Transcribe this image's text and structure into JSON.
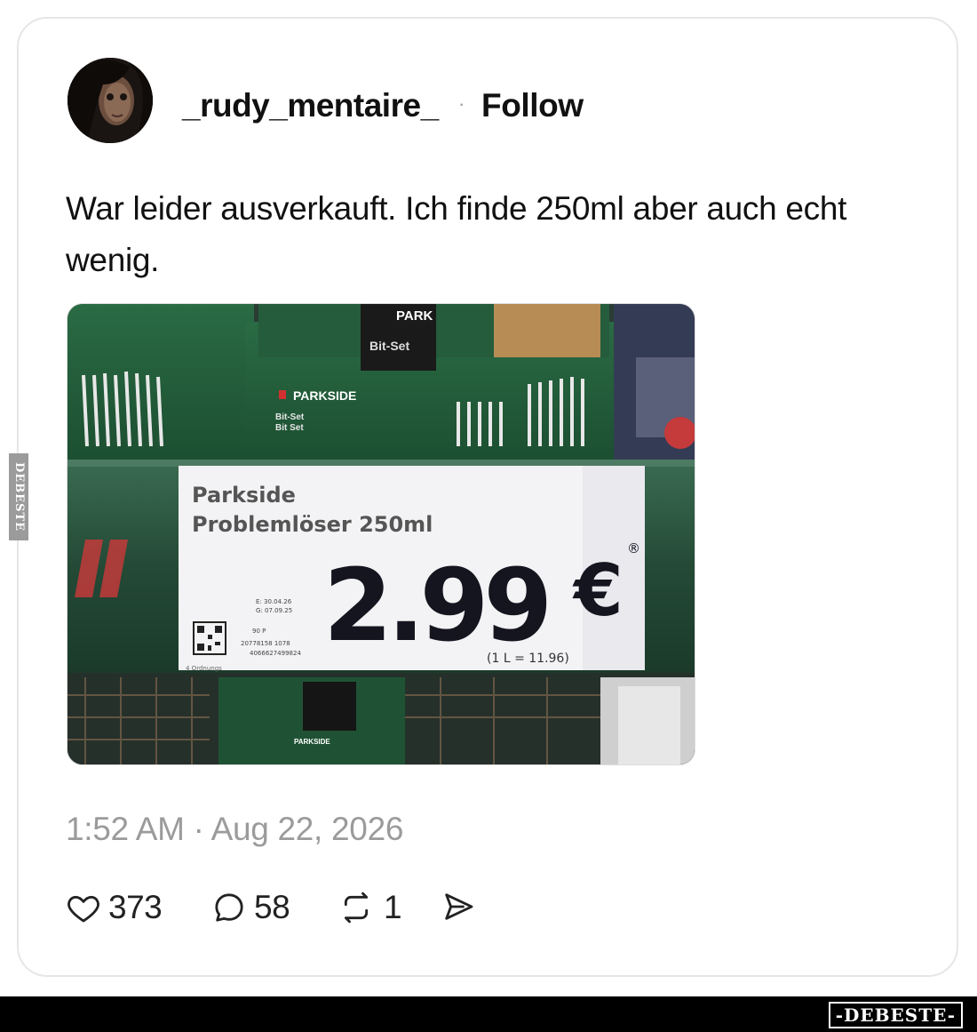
{
  "post": {
    "username": "_rudy_mentaire_",
    "separator": "·",
    "follow_label": "Follow",
    "text": "War leider ausverkauft. Ich finde 250ml aber auch echt wenig.",
    "timestamp": "1:52 AM · Aug 22, 2026"
  },
  "photo": {
    "brand_top": "PARK",
    "bitset_top": "Bit-Set",
    "box_brand": "PARKSIDE",
    "box_bitset": "Bit-Set",
    "box_bitset2": "Bit Set",
    "price_tag": {
      "line1": "Parkside",
      "line2": "Problemlöser 250ml",
      "price": "2.99",
      "currency": "€",
      "registered": "®",
      "unit_price": "(1 L = 11.96)",
      "code_e": "E: 30.04.26",
      "code_g": "G: 07.09.25",
      "code_90": "90      P",
      "code_art": "20778158      1078",
      "ean": "4066627499824",
      "footer_small": "4 Ordnungs"
    },
    "bottom_brand": "PARKSIDE"
  },
  "actions": {
    "likes": "373",
    "comments": "58",
    "reposts": "1"
  },
  "watermarks": {
    "side": "DEBESTE",
    "footer": "-DEBESTE-"
  },
  "colors": {
    "shelf_green": "#2d5a40",
    "box_green": "#1f5a38",
    "tag_white": "#f3f3f5",
    "muted_text": "#9b9b9b"
  }
}
